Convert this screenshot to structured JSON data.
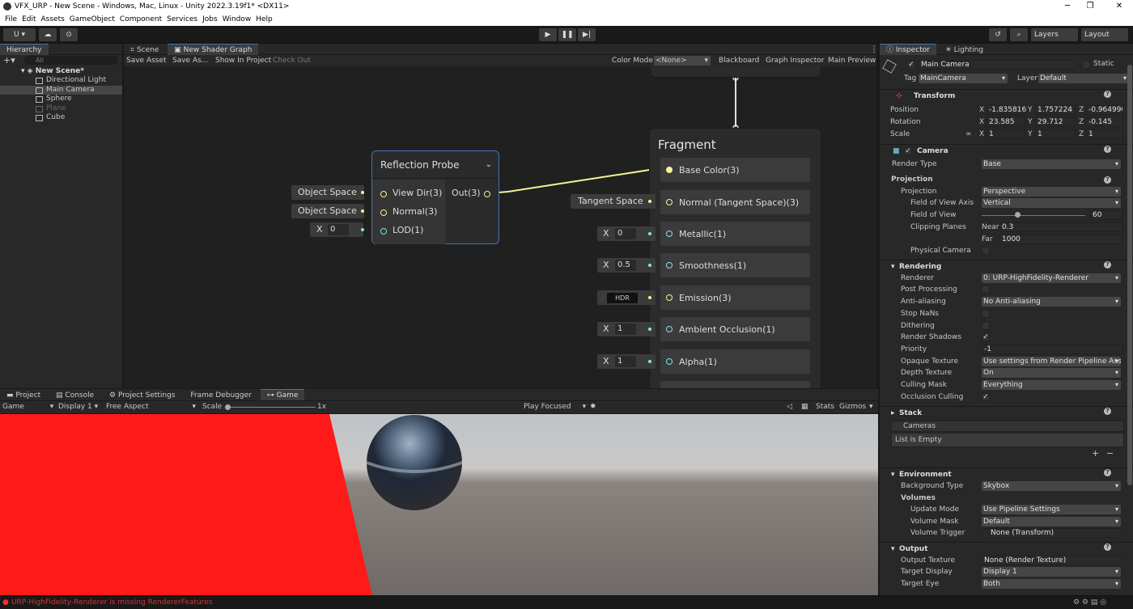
{
  "window": {
    "title": "VFX_URP - New Scene - Windows, Mac, Linux - Unity 2022.3.19f1* <DX11>"
  },
  "menu": [
    "File",
    "Edit",
    "Assets",
    "GameObject",
    "Component",
    "Services",
    "Jobs",
    "Window",
    "Help"
  ],
  "toolbar": {
    "account": "U ▾",
    "layers": "Layers",
    "layout": "Layout"
  },
  "hierarchy": {
    "tab": "Hierarchy",
    "search_placeholder": "All",
    "scene": "New Scene*",
    "items": [
      "Directional Light",
      "Main Camera",
      "Sphere",
      "Plane",
      "Cube"
    ]
  },
  "graph": {
    "tabs": [
      "Scene",
      "New Shader Graph"
    ],
    "actions": [
      "Save Asset",
      "Save As...",
      "Show In Project",
      "Check Out"
    ],
    "color_mode_label": "Color Mode",
    "color_mode_value": "<None>",
    "toggles": [
      "Blackboard",
      "Graph Inspector",
      "Main Preview"
    ],
    "reflection_node": {
      "title": "Reflection Probe",
      "inputs": [
        "View Dir(3)",
        "Normal(3)",
        "LOD(1)"
      ],
      "output": "Out(3)",
      "view_dir_space": "Object Space",
      "normal_space": "Object Space",
      "lod_axis": "X",
      "lod_value": "0"
    },
    "fragment": {
      "title": "Fragment",
      "slots": [
        "Base Color(3)",
        "Normal (Tangent Space)(3)",
        "Metallic(1)",
        "Smoothness(1)",
        "Emission(3)",
        "Ambient Occlusion(1)",
        "Alpha(1)"
      ],
      "normal_space": "Tangent Space",
      "metallic": "0",
      "smoothness": "0.5",
      "emission": "HDR",
      "ao": "1",
      "alpha": "1",
      "axis": "X"
    }
  },
  "bottom": {
    "tabs": [
      "Project",
      "Console",
      "Project Settings",
      "Frame Debugger",
      "Game"
    ],
    "game_mode": "Game",
    "display": "Display 1",
    "aspect": "Free Aspect",
    "scale_label": "Scale",
    "scale_value": "1x",
    "play_mode": "Play Focused",
    "stats": "Stats",
    "gizmos": "Gizmos"
  },
  "inspector": {
    "tabs": [
      "Inspector",
      "Lighting"
    ],
    "object_name": "Main Camera",
    "static_label": "Static",
    "tag_label": "Tag",
    "tag": "MainCamera",
    "layer_label": "Layer",
    "layer": "Default",
    "transform": {
      "title": "Transform",
      "position_label": "Position",
      "rotation_label": "Rotation",
      "scale_label": "Scale",
      "position": [
        "-1.835816",
        "1.757224",
        "-0.964990"
      ],
      "rotation": [
        "23.585",
        "29.712",
        "-0.145"
      ],
      "scale": [
        "1",
        "1",
        "1"
      ],
      "axes": [
        "X",
        "Y",
        "Z"
      ]
    },
    "camera": {
      "title": "Camera",
      "render_type_label": "Render Type",
      "render_type": "Base",
      "projection_section": "Projection",
      "projection_label": "Projection",
      "projection": "Perspective",
      "fov_axis_label": "Field of View Axis",
      "fov_axis": "Vertical",
      "fov_label": "Field of View",
      "fov": "60",
      "fov_fraction": 0.34,
      "clip_label": "Clipping Planes",
      "near_label": "Near",
      "near": "0.3",
      "far_label": "Far",
      "far": "1000",
      "physical_label": "Physical Camera"
    },
    "rendering": {
      "title": "Rendering",
      "renderer_label": "Renderer",
      "renderer": "0: URP-HighFidelity-Renderer",
      "post_label": "Post Processing",
      "aa_label": "Anti-aliasing",
      "aa": "No Anti-aliasing",
      "nan_label": "Stop NaNs",
      "dither_label": "Dithering",
      "shadows_label": "Render Shadows",
      "priority_label": "Priority",
      "priority": "-1",
      "opaque_label": "Opaque Texture",
      "opaque": "Use settings from Render Pipeline Asset",
      "depth_label": "Depth Texture",
      "depth": "On",
      "culling_label": "Culling Mask",
      "culling": "Everything",
      "occlusion_label": "Occlusion Culling"
    },
    "stack": {
      "title": "Stack",
      "cameras_label": "Cameras",
      "empty": "List is Empty",
      "add": "+",
      "remove": "−"
    },
    "environment": {
      "title": "Environment",
      "bg_label": "Background Type",
      "bg": "Skybox",
      "volumes_label": "Volumes",
      "update_label": "Update Mode",
      "update": "Use Pipeline Settings",
      "mask_label": "Volume Mask",
      "mask": "Default",
      "trigger_label": "Volume Trigger",
      "trigger": "None (Transform)"
    },
    "output": {
      "title": "Output",
      "tex_label": "Output Texture",
      "tex": "None (Render Texture)",
      "display_label": "Target Display",
      "display": "Display 1",
      "eye_label": "Target Eye",
      "eye": "Both"
    }
  },
  "status": {
    "message": "URP-HighFidelity-Renderer is missing RendererFeatures"
  }
}
